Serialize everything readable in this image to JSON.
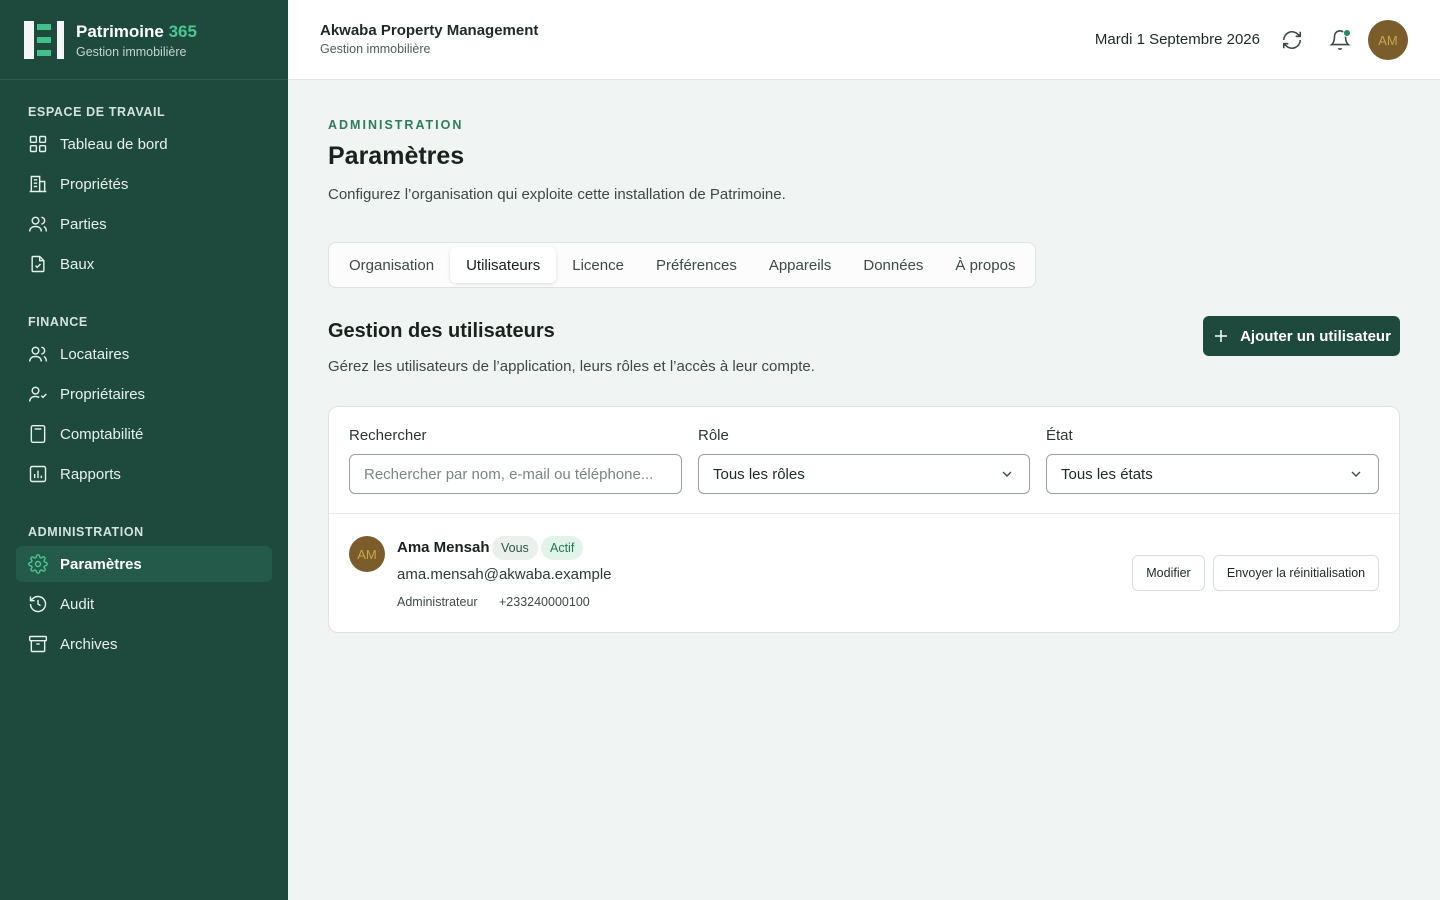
{
  "brand": {
    "name": "Patrimoine",
    "name_accent": "365",
    "subtitle": "Gestion immobilière"
  },
  "sidebar": {
    "sections": [
      {
        "title": "ESPACE DE TRAVAIL",
        "items": [
          {
            "label": "Tableau de bord",
            "icon": "dashboard-icon"
          },
          {
            "label": "Propriétés",
            "icon": "building-icon"
          },
          {
            "label": "Parties",
            "icon": "users-icon"
          },
          {
            "label": "Baux",
            "icon": "document-icon"
          }
        ]
      },
      {
        "title": "FINANCE",
        "items": [
          {
            "label": "Locataires",
            "icon": "users-icon"
          },
          {
            "label": "Propriétaires",
            "icon": "user-check-icon"
          },
          {
            "label": "Comptabilité",
            "icon": "calculator-icon"
          },
          {
            "label": "Rapports",
            "icon": "report-icon"
          }
        ]
      },
      {
        "title": "ADMINISTRATION",
        "items": [
          {
            "label": "Paramètres",
            "icon": "gear-icon",
            "active": true
          },
          {
            "label": "Audit",
            "icon": "history-icon"
          },
          {
            "label": "Archives",
            "icon": "archive-icon"
          }
        ]
      }
    ]
  },
  "header": {
    "org_name": "Akwaba Property Management",
    "org_subtitle": "Gestion immobilière",
    "date": "Mardi 1 Septembre 2026",
    "avatar_initials": "AM"
  },
  "page": {
    "eyebrow": "ADMINISTRATION",
    "title": "Paramètres",
    "description": "Configurez l’organisation qui exploite cette installation de Patrimoine.",
    "tabs": [
      "Organisation",
      "Utilisateurs",
      "Licence",
      "Préférences",
      "Appareils",
      "Données",
      "À propos"
    ],
    "active_tab": "Utilisateurs"
  },
  "users": {
    "title": "Gestion des utilisateurs",
    "description": "Gérez les utilisateurs de l’application, leurs rôles et l’accès à leur compte.",
    "add_label": "Ajouter un utilisateur",
    "filters": {
      "search_label": "Rechercher",
      "search_placeholder": "Rechercher par nom, e-mail ou téléphone...",
      "role_label": "Rôle",
      "role_value": "Tous les rôles",
      "state_label": "État",
      "state_value": "Tous les états"
    },
    "list": [
      {
        "initials": "AM",
        "name": "Ama Mensah",
        "badge_you": "Vous",
        "status": "Actif",
        "email": "ama.mensah@akwaba.example",
        "role": "Administrateur",
        "phone": "+233240000100",
        "edit_label": "Modifier",
        "reset_label": "Envoyer la réinitialisation"
      }
    ]
  },
  "colors": {
    "sidebar": "#1d4a3c",
    "accent": "#2d7d5b",
    "avatar": "#7b5c2b"
  }
}
